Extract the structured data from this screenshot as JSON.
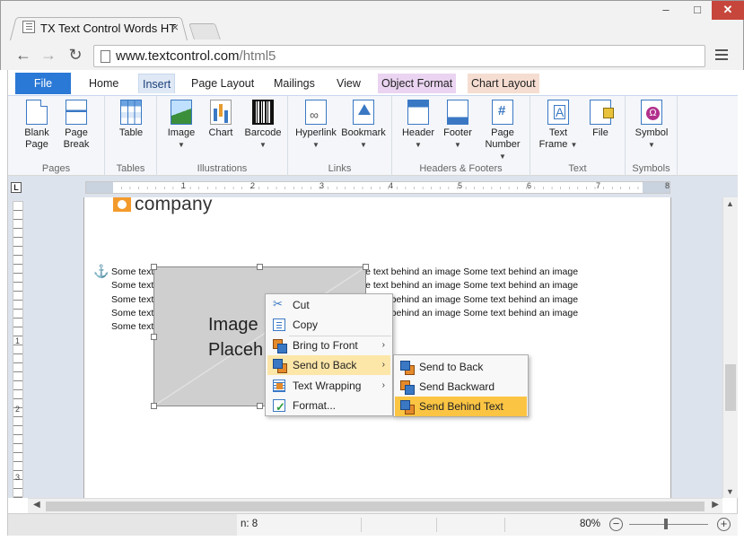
{
  "browser": {
    "tab_title": "TX Text Control Words HT",
    "tab_close": "×",
    "url_host": "www.textcontrol.com",
    "url_path": "/html5",
    "win_min": "–",
    "win_max": "□",
    "win_close": "✕",
    "nav_back": "←",
    "nav_forward": "→",
    "nav_reload": "↻"
  },
  "ribbon_tabs": {
    "file": "File",
    "home": "Home",
    "insert": "Insert",
    "page_layout": "Page Layout",
    "mailings": "Mailings",
    "view": "View",
    "object_format": "Object Format",
    "chart_layout": "Chart Layout"
  },
  "ribbon": {
    "pages": {
      "label": "Pages",
      "blank_page": [
        "Blank",
        "Page"
      ],
      "page_break": [
        "Page",
        "Break"
      ]
    },
    "tables": {
      "label": "Tables",
      "table": "Table"
    },
    "illustrations": {
      "label": "Illustrations",
      "image": "Image",
      "chart": "Chart",
      "barcode": "Barcode"
    },
    "links": {
      "label": "Links",
      "hyperlink": "Hyperlink",
      "bookmark": "Bookmark"
    },
    "headers_footers": {
      "label": "Headers & Footers",
      "header": "Header",
      "footer": "Footer",
      "page_number": [
        "Page",
        "Number"
      ]
    },
    "text": {
      "label": "Text",
      "text_frame": [
        "Text",
        "Frame"
      ],
      "file": "File"
    },
    "symbols": {
      "label": "Symbols",
      "symbol": "Symbol"
    }
  },
  "ruler": {
    "numbers": [
      "1",
      "2",
      "3",
      "4",
      "5",
      "6",
      "7",
      "8"
    ],
    "vnumbers": [
      "1",
      "2",
      "3"
    ]
  },
  "document": {
    "logo_text": "company",
    "paragraph_line": "Some text behind an image Some text behind an image Some text behind an image Some text behind an image",
    "paragraph_last": "Some text behind an image",
    "image_placeholder": [
      "Image",
      "Placeh"
    ]
  },
  "context_menu": {
    "items": [
      "Cut",
      "Copy",
      "Bring to Front",
      "Send to Back",
      "Text Wrapping",
      "Format..."
    ],
    "submenu": [
      "Send to Back",
      "Send Backward",
      "Send Behind Text"
    ]
  },
  "statusbar": {
    "position": "n: 8",
    "zoom": "80%",
    "zoom_minus": "−",
    "zoom_plus": "+"
  },
  "colors": {
    "file_tab": "#2b79d6",
    "object_format_tab": "#ead4f1",
    "chart_layout_tab": "#f6ddd1",
    "menu_highlight": "#fce6a8",
    "submenu_highlight": "#fbc443",
    "logo_orange": "#f39a2c",
    "window_close": "#c7463c"
  },
  "icons": [
    "cut-icon",
    "copy-icon",
    "bring-to-front-icon",
    "send-to-back-icon",
    "text-wrapping-icon",
    "format-icon",
    "anchor-icon"
  ]
}
